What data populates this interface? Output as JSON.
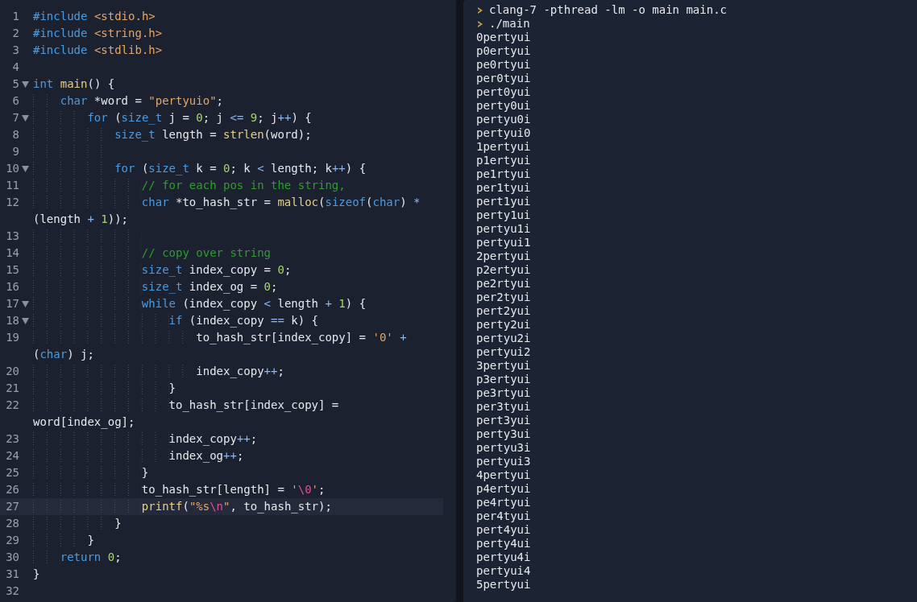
{
  "editor": {
    "lines": [
      {
        "number": "1",
        "foldable": false,
        "active": false,
        "rows": [
          [
            {
              "kind": "pp",
              "text": "#include"
            },
            {
              "kind": "plain",
              "text": " "
            },
            {
              "kind": "header",
              "text": "<stdio.h>"
            }
          ]
        ]
      },
      {
        "number": "2",
        "foldable": false,
        "active": false,
        "rows": [
          [
            {
              "kind": "pp",
              "text": "#include"
            },
            {
              "kind": "plain",
              "text": " "
            },
            {
              "kind": "header",
              "text": "<string.h>"
            }
          ]
        ]
      },
      {
        "number": "3",
        "foldable": false,
        "active": false,
        "rows": [
          [
            {
              "kind": "pp",
              "text": "#include"
            },
            {
              "kind": "plain",
              "text": " "
            },
            {
              "kind": "header",
              "text": "<stdlib.h>"
            }
          ]
        ]
      },
      {
        "number": "4",
        "foldable": false,
        "active": false
      },
      {
        "number": "5",
        "foldable": true,
        "active": false,
        "rows": [
          [
            {
              "kind": "kw",
              "text": "int"
            },
            {
              "kind": "plain",
              "text": " "
            },
            {
              "kind": "fn",
              "text": "main"
            },
            {
              "kind": "plain",
              "text": "() {"
            }
          ]
        ]
      },
      {
        "number": "6",
        "foldable": false,
        "active": false,
        "rows": [
          [
            {
              "kind": "kw",
              "text": "    char"
            },
            {
              "kind": "plain",
              "text": " *word = "
            },
            {
              "kind": "str",
              "text": "\"pertyuio\""
            },
            {
              "kind": "plain",
              "text": ";"
            }
          ]
        ]
      },
      {
        "number": "7",
        "foldable": true,
        "active": false,
        "rows": [
          [
            {
              "kind": "kw",
              "text": "        for"
            },
            {
              "kind": "plain",
              "text": " ("
            },
            {
              "kind": "kw",
              "text": "size_t"
            },
            {
              "kind": "plain",
              "text": " j = "
            },
            {
              "kind": "num",
              "text": "0"
            },
            {
              "kind": "plain",
              "text": "; j "
            },
            {
              "kind": "op",
              "text": "<="
            },
            {
              "kind": "plain",
              "text": " "
            },
            {
              "kind": "num",
              "text": "9"
            },
            {
              "kind": "plain",
              "text": "; j"
            },
            {
              "kind": "op",
              "text": "++"
            },
            {
              "kind": "plain",
              "text": ") {"
            }
          ]
        ]
      },
      {
        "number": "8",
        "foldable": false,
        "active": false,
        "rows": [
          [
            {
              "kind": "kw",
              "text": "            size_t"
            },
            {
              "kind": "plain",
              "text": " length = "
            },
            {
              "kind": "fn",
              "text": "strlen"
            },
            {
              "kind": "plain",
              "text": "(word);"
            }
          ]
        ]
      },
      {
        "number": "9",
        "foldable": false,
        "active": false
      },
      {
        "number": "10",
        "foldable": true,
        "active": false,
        "rows": [
          [
            {
              "kind": "kw",
              "text": "            for"
            },
            {
              "kind": "plain",
              "text": " ("
            },
            {
              "kind": "kw",
              "text": "size_t"
            },
            {
              "kind": "plain",
              "text": " k = "
            },
            {
              "kind": "num",
              "text": "0"
            },
            {
              "kind": "plain",
              "text": "; k "
            },
            {
              "kind": "op",
              "text": "<"
            },
            {
              "kind": "plain",
              "text": " length; k"
            },
            {
              "kind": "op",
              "text": "++"
            },
            {
              "kind": "plain",
              "text": ") {"
            }
          ]
        ]
      },
      {
        "number": "11",
        "foldable": false,
        "active": false,
        "rows": [
          [
            {
              "kind": "comment",
              "text": "                // for each pos in the string,"
            }
          ]
        ]
      },
      {
        "number": "12",
        "foldable": false,
        "active": false,
        "rows": [
          [
            {
              "kind": "kw",
              "text": "                char"
            },
            {
              "kind": "plain",
              "text": " *to_hash_str = "
            },
            {
              "kind": "fn",
              "text": "malloc"
            },
            {
              "kind": "plain",
              "text": "("
            },
            {
              "kind": "kw",
              "text": "sizeof"
            },
            {
              "kind": "plain",
              "text": "("
            },
            {
              "kind": "kw",
              "text": "char"
            },
            {
              "kind": "plain",
              "text": ") "
            },
            {
              "kind": "op",
              "text": "*"
            }
          ],
          [
            {
              "kind": "plain",
              "text": "(length "
            },
            {
              "kind": "op",
              "text": "+"
            },
            {
              "kind": "plain",
              "text": " "
            },
            {
              "kind": "num",
              "text": "1"
            },
            {
              "kind": "plain",
              "text": "));"
            }
          ]
        ]
      },
      {
        "number": "13",
        "foldable": false,
        "active": false
      },
      {
        "number": "14",
        "foldable": false,
        "active": false,
        "rows": [
          [
            {
              "kind": "comment",
              "text": "                // copy over string"
            }
          ]
        ]
      },
      {
        "number": "15",
        "foldable": false,
        "active": false,
        "rows": [
          [
            {
              "kind": "kw",
              "text": "                size_t"
            },
            {
              "kind": "plain",
              "text": " index_copy = "
            },
            {
              "kind": "num",
              "text": "0"
            },
            {
              "kind": "plain",
              "text": ";"
            }
          ]
        ]
      },
      {
        "number": "16",
        "foldable": false,
        "active": false,
        "rows": [
          [
            {
              "kind": "kw",
              "text": "                size_t"
            },
            {
              "kind": "plain",
              "text": " index_og = "
            },
            {
              "kind": "num",
              "text": "0"
            },
            {
              "kind": "plain",
              "text": ";"
            }
          ]
        ]
      },
      {
        "number": "17",
        "foldable": true,
        "active": false,
        "rows": [
          [
            {
              "kind": "kw",
              "text": "                while"
            },
            {
              "kind": "plain",
              "text": " (index_copy "
            },
            {
              "kind": "op",
              "text": "<"
            },
            {
              "kind": "plain",
              "text": " length "
            },
            {
              "kind": "op",
              "text": "+"
            },
            {
              "kind": "plain",
              "text": " "
            },
            {
              "kind": "num",
              "text": "1"
            },
            {
              "kind": "plain",
              "text": ") {"
            }
          ]
        ]
      },
      {
        "number": "18",
        "foldable": true,
        "active": false,
        "rows": [
          [
            {
              "kind": "kw",
              "text": "                    if"
            },
            {
              "kind": "plain",
              "text": " (index_copy "
            },
            {
              "kind": "op",
              "text": "=="
            },
            {
              "kind": "plain",
              "text": " k) {"
            }
          ]
        ]
      },
      {
        "number": "19",
        "foldable": false,
        "active": false,
        "rows": [
          [
            {
              "kind": "plain",
              "text": "                        to_hash_str[index_copy] = "
            },
            {
              "kind": "str",
              "text": "'0'"
            },
            {
              "kind": "plain",
              "text": " "
            },
            {
              "kind": "op",
              "text": "+"
            }
          ],
          [
            {
              "kind": "plain",
              "text": "("
            },
            {
              "kind": "kw",
              "text": "char"
            },
            {
              "kind": "plain",
              "text": ") j;"
            }
          ]
        ]
      },
      {
        "number": "20",
        "foldable": false,
        "active": false,
        "rows": [
          [
            {
              "kind": "plain",
              "text": "                        index_copy"
            },
            {
              "kind": "op",
              "text": "++"
            },
            {
              "kind": "plain",
              "text": ";"
            }
          ]
        ]
      },
      {
        "number": "21",
        "foldable": false,
        "active": false,
        "rows": [
          [
            {
              "kind": "plain",
              "text": "                    }"
            }
          ]
        ]
      },
      {
        "number": "22",
        "foldable": false,
        "active": false,
        "rows": [
          [
            {
              "kind": "plain",
              "text": "                    to_hash_str[index_copy] ="
            }
          ],
          [
            {
              "kind": "plain",
              "text": "word[index_og];"
            }
          ]
        ]
      },
      {
        "number": "23",
        "foldable": false,
        "active": false,
        "rows": [
          [
            {
              "kind": "plain",
              "text": "                    index_copy"
            },
            {
              "kind": "op",
              "text": "++"
            },
            {
              "kind": "plain",
              "text": ";"
            }
          ]
        ]
      },
      {
        "number": "24",
        "foldable": false,
        "active": false,
        "rows": [
          [
            {
              "kind": "plain",
              "text": "                    index_og"
            },
            {
              "kind": "op",
              "text": "++"
            },
            {
              "kind": "plain",
              "text": ";"
            }
          ]
        ]
      },
      {
        "number": "25",
        "foldable": false,
        "active": false,
        "rows": [
          [
            {
              "kind": "plain",
              "text": "                }"
            }
          ]
        ]
      },
      {
        "number": "26",
        "foldable": false,
        "active": false,
        "rows": [
          [
            {
              "kind": "plain",
              "text": "                to_hash_str[length] = "
            },
            {
              "kind": "str",
              "text": "'"
            },
            {
              "kind": "esc",
              "text": "\\0"
            },
            {
              "kind": "str",
              "text": "'"
            },
            {
              "kind": "plain",
              "text": ";"
            }
          ]
        ]
      },
      {
        "number": "27",
        "foldable": false,
        "active": true,
        "rows": [
          [
            {
              "kind": "fn",
              "text": "                printf"
            },
            {
              "kind": "plain",
              "text": "("
            },
            {
              "kind": "str",
              "text": "\"%s"
            },
            {
              "kind": "esc",
              "text": "\\n"
            },
            {
              "kind": "str",
              "text": "\""
            },
            {
              "kind": "plain",
              "text": ", to_hash_str);"
            }
          ]
        ]
      },
      {
        "number": "28",
        "foldable": false,
        "active": false,
        "rows": [
          [
            {
              "kind": "plain",
              "text": "            }"
            }
          ]
        ]
      },
      {
        "number": "29",
        "foldable": false,
        "active": false,
        "rows": [
          [
            {
              "kind": "plain",
              "text": "        }"
            }
          ]
        ]
      },
      {
        "number": "30",
        "foldable": false,
        "active": false,
        "rows": [
          [
            {
              "kind": "kw",
              "text": "    return"
            },
            {
              "kind": "plain",
              "text": " "
            },
            {
              "kind": "num",
              "text": "0"
            },
            {
              "kind": "plain",
              "text": ";"
            }
          ]
        ]
      },
      {
        "number": "31",
        "foldable": false,
        "active": false,
        "rows": [
          [
            {
              "kind": "plain",
              "text": "}"
            }
          ]
        ]
      },
      {
        "number": "32",
        "foldable": false,
        "active": false
      }
    ]
  },
  "terminal": {
    "lines": [
      {
        "kind": "command",
        "text": "clang-7 -pthread -lm -o main main.c"
      },
      {
        "kind": "command",
        "text": "./main"
      },
      {
        "kind": "output",
        "text": "0pertyui"
      },
      {
        "kind": "output",
        "text": "p0ertyui"
      },
      {
        "kind": "output",
        "text": "pe0rtyui"
      },
      {
        "kind": "output",
        "text": "per0tyui"
      },
      {
        "kind": "output",
        "text": "pert0yui"
      },
      {
        "kind": "output",
        "text": "perty0ui"
      },
      {
        "kind": "output",
        "text": "pertyu0i"
      },
      {
        "kind": "output",
        "text": "pertyui0"
      },
      {
        "kind": "output",
        "text": "1pertyui"
      },
      {
        "kind": "output",
        "text": "p1ertyui"
      },
      {
        "kind": "output",
        "text": "pe1rtyui"
      },
      {
        "kind": "output",
        "text": "per1tyui"
      },
      {
        "kind": "output",
        "text": "pert1yui"
      },
      {
        "kind": "output",
        "text": "perty1ui"
      },
      {
        "kind": "output",
        "text": "pertyu1i"
      },
      {
        "kind": "output",
        "text": "pertyui1"
      },
      {
        "kind": "output",
        "text": "2pertyui"
      },
      {
        "kind": "output",
        "text": "p2ertyui"
      },
      {
        "kind": "output",
        "text": "pe2rtyui"
      },
      {
        "kind": "output",
        "text": "per2tyui"
      },
      {
        "kind": "output",
        "text": "pert2yui"
      },
      {
        "kind": "output",
        "text": "perty2ui"
      },
      {
        "kind": "output",
        "text": "pertyu2i"
      },
      {
        "kind": "output",
        "text": "pertyui2"
      },
      {
        "kind": "output",
        "text": "3pertyui"
      },
      {
        "kind": "output",
        "text": "p3ertyui"
      },
      {
        "kind": "output",
        "text": "pe3rtyui"
      },
      {
        "kind": "output",
        "text": "per3tyui"
      },
      {
        "kind": "output",
        "text": "pert3yui"
      },
      {
        "kind": "output",
        "text": "perty3ui"
      },
      {
        "kind": "output",
        "text": "pertyu3i"
      },
      {
        "kind": "output",
        "text": "pertyui3"
      },
      {
        "kind": "output",
        "text": "4pertyui"
      },
      {
        "kind": "output",
        "text": "p4ertyui"
      },
      {
        "kind": "output",
        "text": "pe4rtyui"
      },
      {
        "kind": "output",
        "text": "per4tyui"
      },
      {
        "kind": "output",
        "text": "pert4yui"
      },
      {
        "kind": "output",
        "text": "perty4ui"
      },
      {
        "kind": "output",
        "text": "pertyu4i"
      },
      {
        "kind": "output",
        "text": "pertyui4"
      },
      {
        "kind": "output",
        "text": "5pertyui"
      }
    ]
  }
}
